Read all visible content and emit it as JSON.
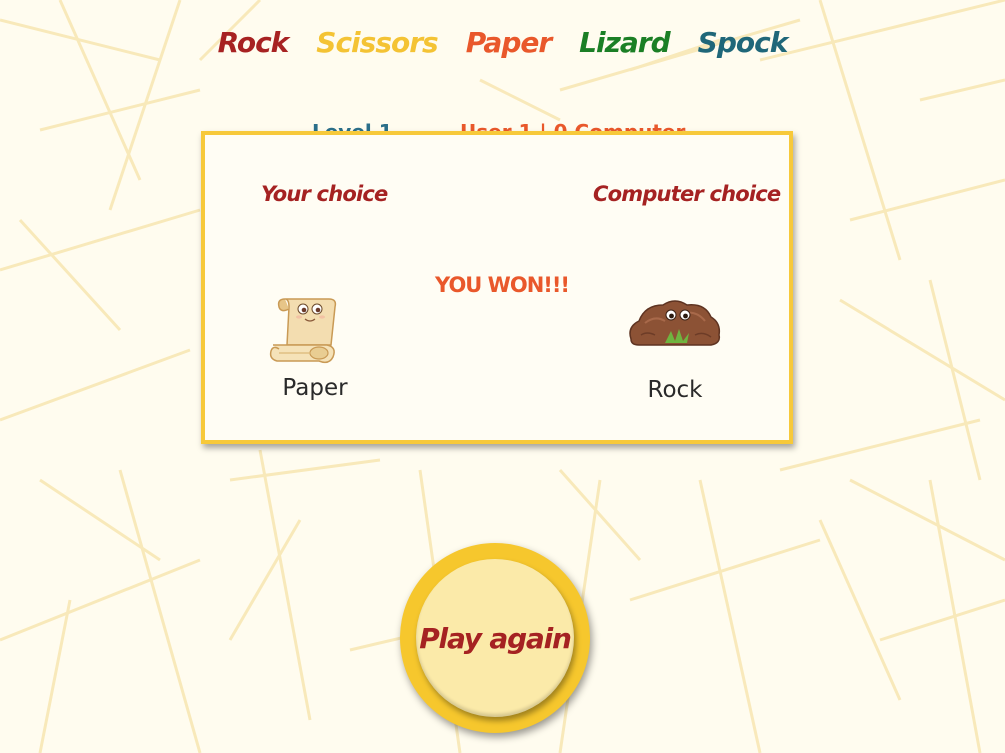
{
  "title": [
    {
      "label": "Rock",
      "color": "#a72222"
    },
    {
      "label": "Scissors",
      "color": "#f4c334"
    },
    {
      "label": "Paper",
      "color": "#e9582b"
    },
    {
      "label": "Lizard",
      "color": "#1b7f25"
    },
    {
      "label": "Spock",
      "color": "#1f6779"
    }
  ],
  "status": {
    "level": "Level 1",
    "score": "User 1 | 0 Computer"
  },
  "result": {
    "your_heading": "Your choice",
    "computer_heading": "Computer choice",
    "outcome": "YOU WON!!!",
    "user_choice": "Paper",
    "user_choice_icon": "paper-scroll-icon",
    "computer_choice": "Rock",
    "computer_choice_icon": "rock-icon"
  },
  "play_again": {
    "label": "Play again"
  }
}
